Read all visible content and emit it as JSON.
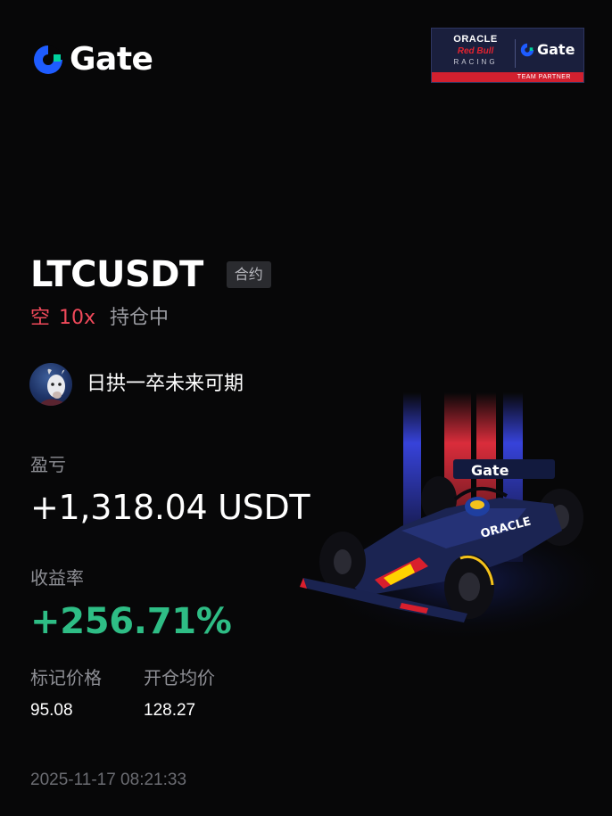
{
  "brand": {
    "name": "Gate",
    "accent_blue": "#1e5cff",
    "accent_green": "#00d29e"
  },
  "partner_badge": {
    "oracle": "ORACLE",
    "red_bull": "Red Bull",
    "racing": "RACING",
    "gate": "Gate",
    "footer": "TEAM PARTNER"
  },
  "position": {
    "pair": "LTCUSDT",
    "type_tag": "合约",
    "side": "空",
    "leverage": "10x",
    "status": "持仓中"
  },
  "user": {
    "avatar_icon": "goat-avatar",
    "username": "日拱一卒未来可期"
  },
  "pnl": {
    "label": "盈亏",
    "value": "+1,318.04 USDT"
  },
  "roi": {
    "label": "收益率",
    "value": "+256.71%"
  },
  "prices": {
    "mark_label": "标记价格",
    "mark_value": "95.08",
    "entry_label": "开仓均价",
    "entry_value": "128.27"
  },
  "timestamp": "2025-11-17 08:21:33",
  "colors": {
    "short_red": "#f0495a",
    "profit_green": "#2ebd85",
    "background": "#070708"
  },
  "car_livery": {
    "sponsor_wing": "Gate",
    "sponsor_side": "ORACLE"
  }
}
